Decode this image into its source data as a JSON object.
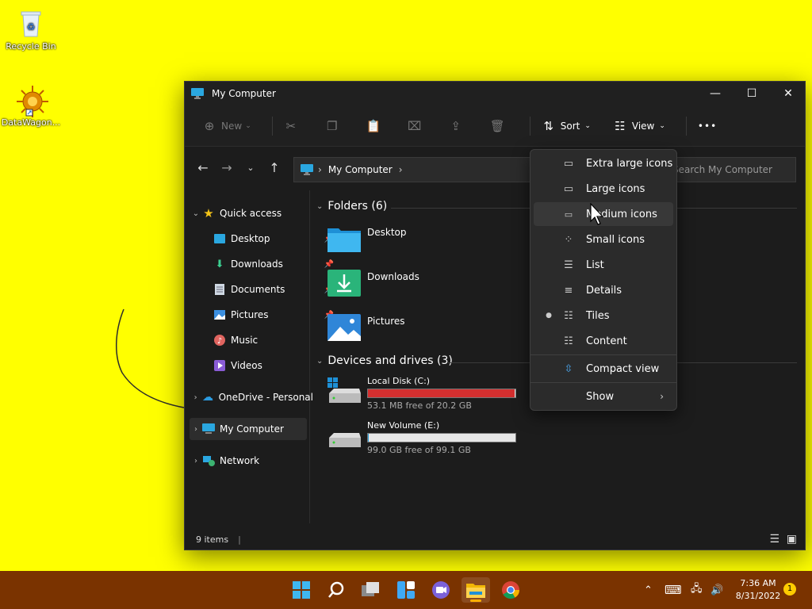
{
  "desktop": {
    "recycle_bin": "Recycle Bin",
    "datawagon": "DataWagon..."
  },
  "window": {
    "title": "My Computer",
    "toolbar": {
      "new_label": "New",
      "sort_label": "Sort",
      "view_label": "View",
      "more_label": "•••"
    },
    "address": {
      "crumb": "My Computer",
      "search_placeholder": "Search My Computer"
    },
    "sidebar": {
      "quick_access": "Quick access",
      "items": [
        {
          "label": "Desktop",
          "pinned": true
        },
        {
          "label": "Downloads",
          "pinned": true
        },
        {
          "label": "Documents",
          "pinned": true
        },
        {
          "label": "Pictures",
          "pinned": true
        },
        {
          "label": "Music",
          "pinned": false
        },
        {
          "label": "Videos",
          "pinned": false
        }
      ],
      "onedrive": "OneDrive - Personal",
      "my_computer": "My Computer",
      "network": "Network"
    },
    "content": {
      "folders_header": "Folders (6)",
      "folders": [
        "Desktop",
        "Downloads",
        "Pictures"
      ],
      "drives_header": "Devices and drives (3)",
      "drives": [
        {
          "name": "Local Disk (C:)",
          "free": "53.1 MB free of 20.2 GB",
          "used_fraction": 0.997,
          "bar_color": "#d32f2f"
        },
        {
          "name": "New Volume (E:)",
          "free": "99.0 GB free of 99.1 GB",
          "used_fraction": 0.001,
          "bar_color": "#26a0da"
        }
      ]
    },
    "status": "9 items"
  },
  "view_menu": {
    "items": [
      {
        "label": "Extra large icons",
        "icon": "monitor-large-icon",
        "selected": false
      },
      {
        "label": "Large icons",
        "icon": "monitor-icon",
        "selected": false
      },
      {
        "label": "Medium icons",
        "icon": "monitor-small-icon",
        "selected": false
      },
      {
        "label": "Small icons",
        "icon": "small-icons-icon",
        "selected": false
      },
      {
        "label": "List",
        "icon": "list-icon",
        "selected": false
      },
      {
        "label": "Details",
        "icon": "details-icon",
        "selected": false
      },
      {
        "label": "Tiles",
        "icon": "tiles-icon",
        "selected": true
      },
      {
        "label": "Content",
        "icon": "content-icon",
        "selected": false
      }
    ],
    "compact_view": "Compact view",
    "show": "Show"
  },
  "taskbar": {
    "time": "7:36 AM",
    "date": "8/31/2022",
    "notifications": "1"
  },
  "colors": {
    "desktop_bg": "#ffff00",
    "taskbar_bg": "#7a3300",
    "accent": "#0078d4"
  }
}
